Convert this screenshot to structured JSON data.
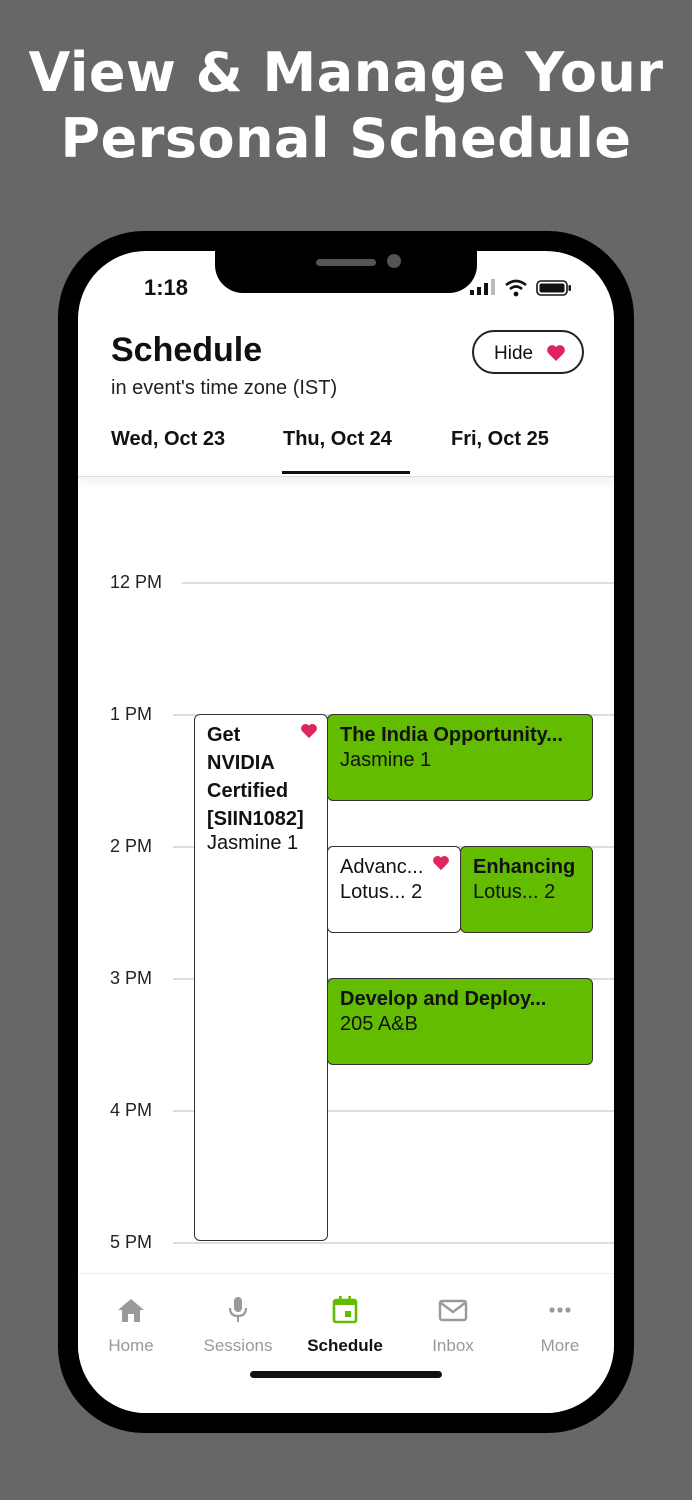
{
  "headline": {
    "line1": "View & Manage Your",
    "line2": "Personal Schedule"
  },
  "status_bar": {
    "time": "1:18",
    "icons": [
      "signal-icon",
      "wifi-icon",
      "battery-icon"
    ]
  },
  "header": {
    "title": "Schedule",
    "subtitle": "in event's time zone (IST)",
    "hide_button": {
      "label": "Hide",
      "icon": "heart-icon"
    }
  },
  "day_tabs": [
    {
      "label": "Wed, Oct 23",
      "selected": false
    },
    {
      "label": "Thu, Oct 24",
      "selected": true
    },
    {
      "label": "Fri, Oct 25",
      "selected": false
    }
  ],
  "time_labels": [
    "12 PM",
    "1 PM",
    "2 PM",
    "3 PM",
    "4 PM",
    "5 PM"
  ],
  "events": [
    {
      "title": "Get NVIDIA Certified [SIIN1082]",
      "title_lines": [
        "Get",
        "NVIDIA",
        "Certified",
        "[SIIN1082]"
      ],
      "location": "Jasmine 1",
      "favorited": true,
      "color": "#ffffff"
    },
    {
      "title": "The India Opportunity...",
      "location": "Jasmine 1",
      "favorited": false,
      "color": "#63bc00"
    },
    {
      "title": "Advanc...",
      "location": "Lotus... 2",
      "favorited": true,
      "color": "#ffffff"
    },
    {
      "title": "Enhancing",
      "location": "Lotus... 2",
      "favorited": false,
      "color": "#63bc00"
    },
    {
      "title": "Develop and Deploy...",
      "location": "205 A&B",
      "favorited": false,
      "color": "#63bc00"
    }
  ],
  "colors": {
    "accent": "#63bc00",
    "heart": "#e0245e",
    "background": "#676767"
  },
  "bottom_nav": [
    {
      "label": "Home",
      "icon": "home-icon",
      "active": false
    },
    {
      "label": "Sessions",
      "icon": "microphone-icon",
      "active": false
    },
    {
      "label": "Schedule",
      "icon": "calendar-icon",
      "active": true
    },
    {
      "label": "Inbox",
      "icon": "mail-icon",
      "active": false
    },
    {
      "label": "More",
      "icon": "more-icon",
      "active": false
    }
  ]
}
